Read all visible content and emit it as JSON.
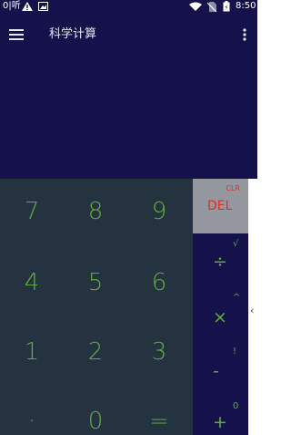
{
  "status_bar": {
    "carrier": "0|听",
    "time": "8:50",
    "icons": [
      "warning-icon",
      "image-icon",
      "wifi-icon",
      "no-sim-icon",
      "battery-icon"
    ]
  },
  "toolbar": {
    "title": "科学计算",
    "menu_icon": "hamburger-menu-icon",
    "more_icon": "more-vertical-icon"
  },
  "display": {
    "expression": "",
    "result": ""
  },
  "keypad": {
    "rows": [
      [
        "7",
        "8",
        "9"
      ],
      [
        "4",
        "5",
        "6"
      ],
      [
        "1",
        "2",
        "3"
      ],
      [
        "·",
        "0",
        "="
      ]
    ]
  },
  "operators": {
    "clear_label": "CLR",
    "delete_label": "DEL",
    "keys": [
      {
        "main": "÷",
        "alt": "√"
      },
      {
        "main": "×",
        "alt": "^"
      },
      {
        "main": "-",
        "alt": "!"
      },
      {
        "main": "+",
        "alt": "0"
      }
    ]
  },
  "drawer": {
    "chevron": "‹"
  },
  "colors": {
    "header_bg": "#15114a",
    "keypad_bg": "#253340",
    "digit_green": "#5fae3f",
    "del_bg": "#95979f",
    "del_red": "#d9312a"
  }
}
